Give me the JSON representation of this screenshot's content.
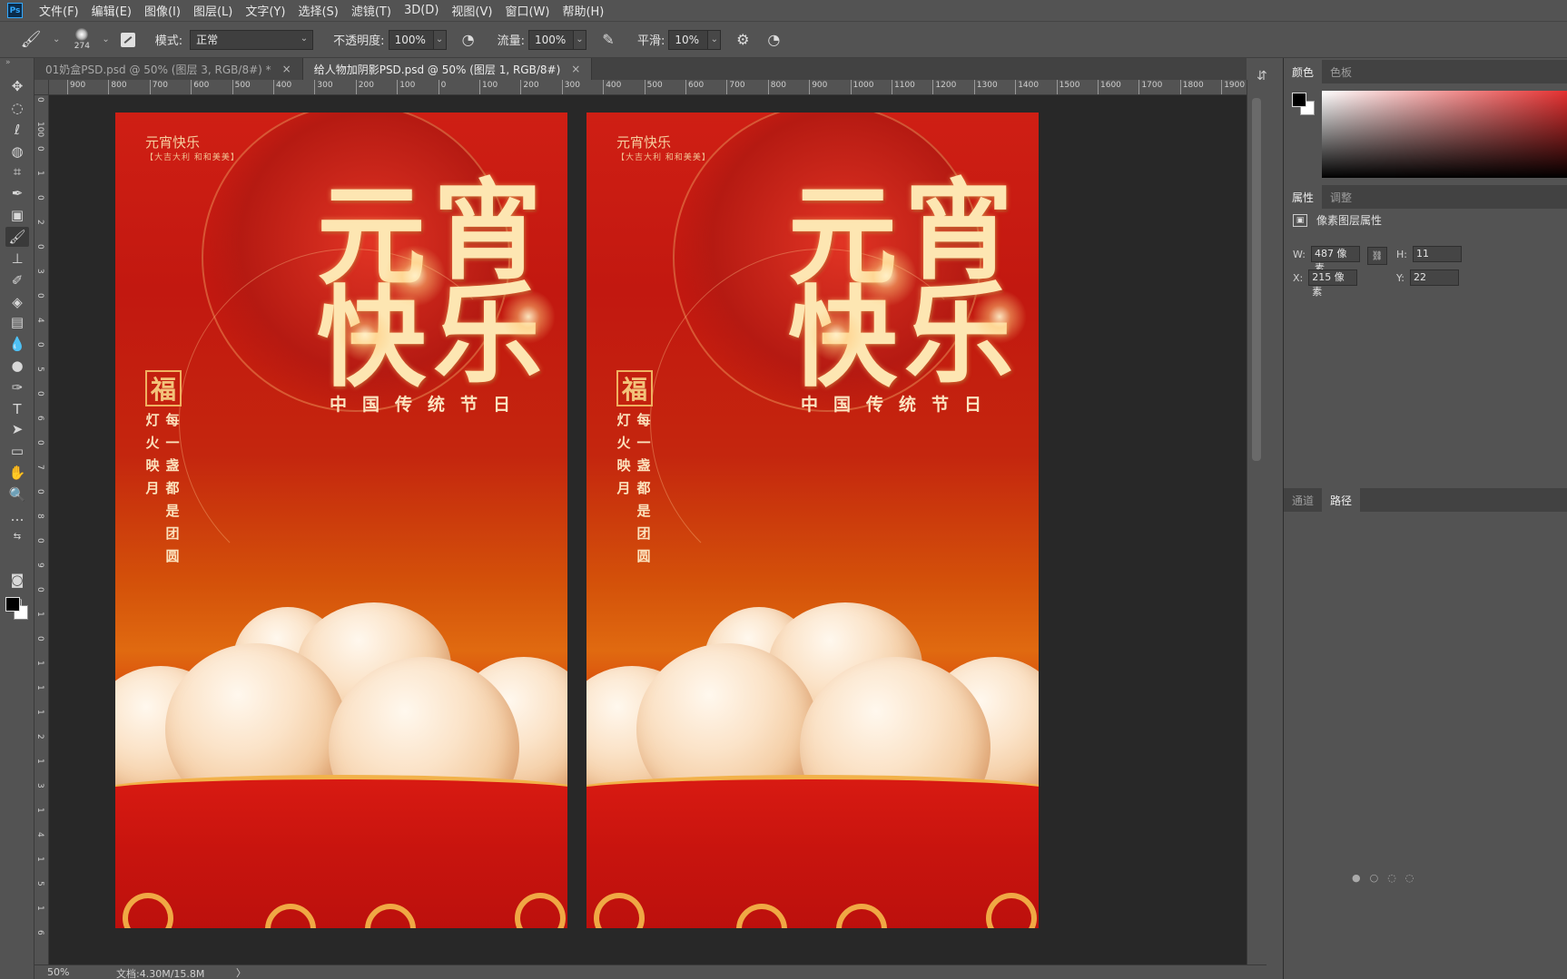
{
  "app": {
    "logo": "Ps",
    "menus": [
      "文件(F)",
      "编辑(E)",
      "图像(I)",
      "图层(L)",
      "文字(Y)",
      "选择(S)",
      "滤镜(T)",
      "3D(D)",
      "视图(V)",
      "窗口(W)",
      "帮助(H)"
    ]
  },
  "options": {
    "brush_size": "274",
    "mode_label": "模式:",
    "mode_value": "正常",
    "opacity_label": "不透明度:",
    "opacity_value": "100%",
    "flow_label": "流量:",
    "flow_value": "100%",
    "smooth_label": "平滑:",
    "smooth_value": "10%"
  },
  "tabs": [
    {
      "label": "01奶盒PSD.psd @ 50% (图层 3, RGB/8#) *",
      "close": "×",
      "active": false
    },
    {
      "label": "给人物加阴影PSD.psd @ 50% (图层 1, RGB/8#)",
      "close": "×",
      "active": true
    }
  ],
  "ruler": {
    "top": [
      "900",
      "800",
      "700",
      "600",
      "500",
      "400",
      "300",
      "200",
      "100",
      "0",
      "100",
      "200",
      "300",
      "400",
      "500",
      "600",
      "700",
      "800",
      "900",
      "1000",
      "1100",
      "1200",
      "1300",
      "1400",
      "1500",
      "1600",
      "1700",
      "1800",
      "1900"
    ],
    "left": [
      "0",
      "100",
      "0",
      "1",
      "0",
      "2",
      "0",
      "3",
      "0",
      "4",
      "0",
      "5",
      "0",
      "6",
      "0",
      "7",
      "0",
      "8",
      "0",
      "9",
      "0",
      "1",
      "0",
      "1",
      "1",
      "1",
      "2",
      "1",
      "3",
      "1",
      "4",
      "1",
      "5",
      "1",
      "6"
    ]
  },
  "poster": {
    "small_title": "元宵快乐",
    "small_sub": "【大吉大利 和和美美】",
    "big_line1_a": "元",
    "big_line1_b": "宵",
    "big_line2_a": "快",
    "big_line2_b": "乐",
    "caption": "中国传统节日",
    "seal": "福",
    "col_left": "灯\n火\n映\n月",
    "col_right": "每\n一\n盏\n都\n是\n团\n圆"
  },
  "status": {
    "zoom": "50%",
    "doc": "文档:4.30M/15.8M",
    "arrow": "〉"
  },
  "panels": {
    "color_tabs": [
      "颜色",
      "色板"
    ],
    "prop_tabs": [
      "属性",
      "调整"
    ],
    "layer_type": "像素图层属性",
    "w_label": "W:",
    "w_value": "487 像素",
    "h_label": "H:",
    "h_value": "11",
    "x_label": "X:",
    "x_value": "215 像素",
    "y_label": "Y:",
    "y_value": "22",
    "bottom_tabs": [
      "通道",
      "路径"
    ]
  },
  "colors": {
    "accent": "#31a8ff",
    "poster_red": "#c8140e",
    "poster_gold": "#fde6b2"
  }
}
